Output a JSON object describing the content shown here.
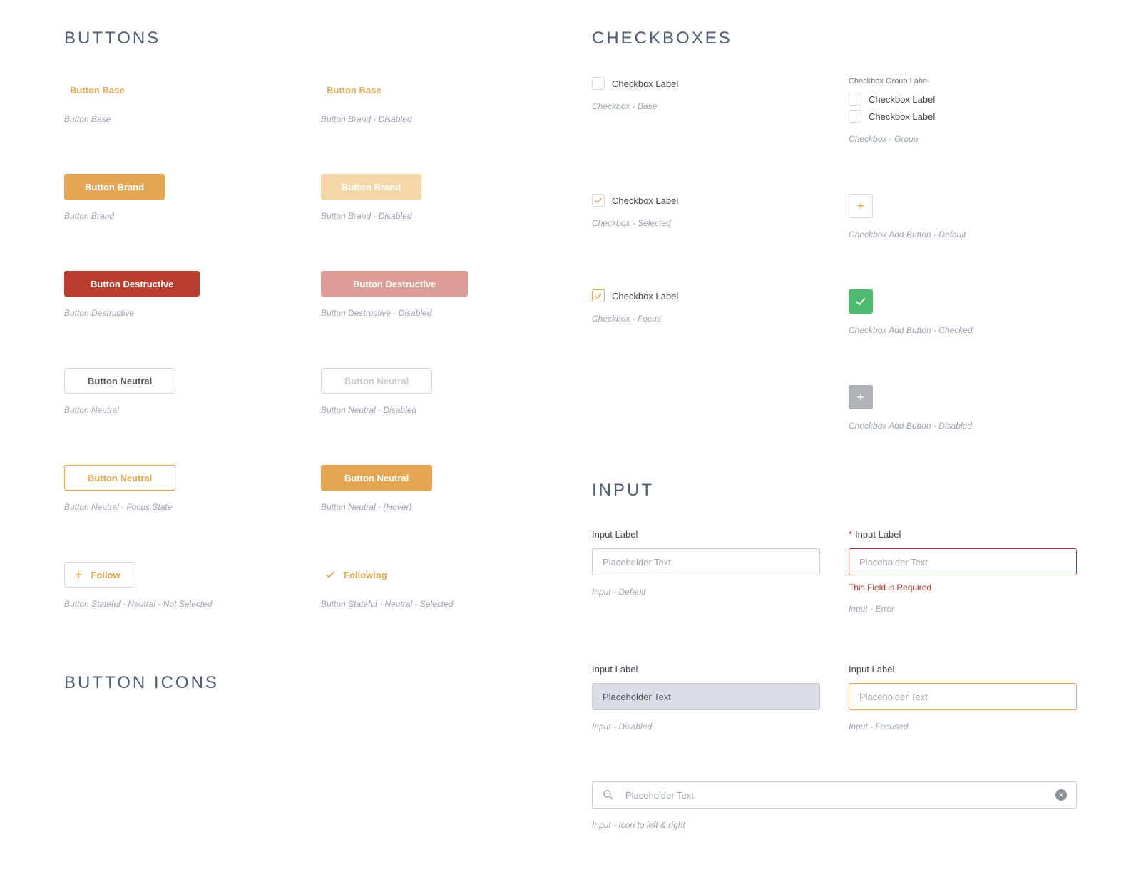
{
  "sections": {
    "buttons": "BUTTONS",
    "button_icons": "BUTTON ICONS",
    "checkboxes": "CHECKBOXES",
    "input": "INPUT"
  },
  "buttons": {
    "base": {
      "label": "Button Base",
      "caption": "Button Base"
    },
    "base_dis": {
      "label": "Button Base",
      "caption": "Button Brand - Disabled"
    },
    "brand": {
      "label": "Button Brand",
      "caption": "Button Brand"
    },
    "brand_dis": {
      "label": "Button Brand",
      "caption": "Button Brand - Disabled"
    },
    "destr": {
      "label": "Button Destructive",
      "caption": "Button Destructive"
    },
    "destr_dis": {
      "label": "Button Destructive",
      "caption": "Button Destructive - Disabled"
    },
    "neutral": {
      "label": "Button Neutral",
      "caption": "Button Neutral"
    },
    "neutral_dis": {
      "label": "Button Neutral",
      "caption": "Button Neutral - Disabled"
    },
    "neutral_focus": {
      "label": "Button Neutral",
      "caption": "Button Neutral - Focus State"
    },
    "neutral_hover": {
      "label": "Button Neutral",
      "caption": "Button Neutral - (Hover)"
    },
    "stateful_off": {
      "label": "Follow",
      "caption": "Button Stateful - Neutral - Not Selected"
    },
    "stateful_on": {
      "label": "Following",
      "caption": "Button Stateful - Neutral - Selected"
    }
  },
  "checkboxes": {
    "base": {
      "label": "Checkbox Label",
      "caption": "Checkbox - Base"
    },
    "selected": {
      "label": "Checkbox Label",
      "caption": "Checkbox - Selected"
    },
    "focus": {
      "label": "Checkbox Label",
      "caption": "Checkbox - Focus"
    },
    "group": {
      "group_label": "Checkbox Group Label",
      "item1": "Checkbox Label",
      "item2": "Checkbox Label",
      "caption": "Checkbox -  Group"
    },
    "add_default": {
      "caption": "Checkbox Add Button -  Default"
    },
    "add_checked": {
      "caption": "Checkbox Add Button -  Checked"
    },
    "add_disabled": {
      "caption": "Checkbox Add Button -  Disabled"
    }
  },
  "inputs": {
    "default": {
      "label": "Input Label",
      "placeholder": "Placeholder Text",
      "caption": "Input - Default"
    },
    "error": {
      "label": "Input Label",
      "placeholder": "Placeholder Text",
      "error": "This Field is Required",
      "caption": "Input - Error",
      "required": "*"
    },
    "disabled": {
      "label": "Input Label",
      "value": "Placeholder Text",
      "caption": "Input - Disabled"
    },
    "focused": {
      "label": "Input Label",
      "placeholder": "Placeholder Text",
      "caption": "Input - Focused"
    },
    "iconed": {
      "placeholder": "Placeholder Text",
      "caption": "Input - Icon to left & right"
    }
  }
}
